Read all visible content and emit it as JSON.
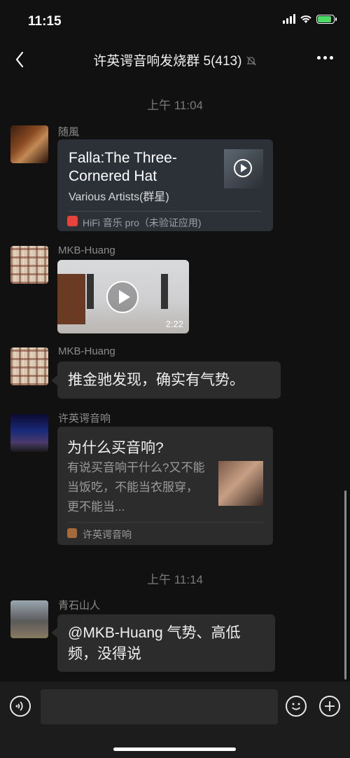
{
  "status": {
    "time": "11:15",
    "battery_level": 0.85
  },
  "header": {
    "title": "许英谔音响发烧群 5(413)"
  },
  "messages": {
    "time1": "上午 11:04",
    "music": {
      "sender": "随風",
      "title": "Falla:The Three-Cornered Hat",
      "artist": "Various Artists(群星)",
      "source": "HiFi 音乐 pro（未验证应用)"
    },
    "video": {
      "sender": "MKB-Huang",
      "duration": "2:22"
    },
    "text1": {
      "sender": "MKB-Huang",
      "text": "推金驰发现，确实有气势。"
    },
    "article": {
      "sender": "许英谔音响",
      "title": "为什么买音响?",
      "desc": "有说买音响干什么?又不能当饭吃，不能当衣服穿，更不能当...",
      "source": "许英谔音响"
    },
    "time2": "上午 11:14",
    "text2": {
      "sender": "青石山人",
      "text": "@MKB-Huang 气势、高低频，没得说"
    }
  },
  "input": {
    "value": ""
  },
  "icons": {
    "back": "chevron-left-icon",
    "mute": "bell-off-icon",
    "more": "more-icon",
    "voice": "voice-icon",
    "emoji": "emoji-icon",
    "add": "plus-icon"
  }
}
